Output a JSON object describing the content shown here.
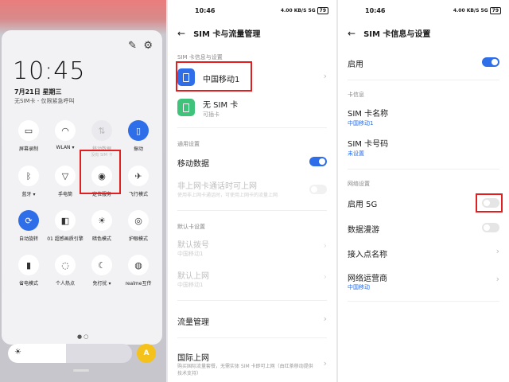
{
  "control_center": {
    "time": "10:45",
    "date": "7月21日 星期三",
    "sim_status": "无SIM卡 - 仅限紧急呼叫",
    "tiles": [
      {
        "label": "屏幕录制",
        "icon": "screen-record-icon",
        "glyph": "▭",
        "state": "off"
      },
      {
        "label": "WLAN ▾",
        "icon": "wifi-icon",
        "glyph": "◠",
        "state": "off"
      },
      {
        "label": "移动数据",
        "sub": "没有 SIM 卡",
        "icon": "mobile-data-icon",
        "glyph": "⇅",
        "state": "dim"
      },
      {
        "label": "振动",
        "icon": "vibrate-icon",
        "glyph": "▯",
        "state": "on"
      },
      {
        "label": "蓝牙 ▾",
        "icon": "bluetooth-icon",
        "glyph": "ᛒ",
        "state": "off"
      },
      {
        "label": "手电筒",
        "icon": "flashlight-icon",
        "glyph": "▽",
        "state": "off"
      },
      {
        "label": "定位服务",
        "icon": "location-icon",
        "glyph": "◉",
        "state": "off"
      },
      {
        "label": "飞行模式",
        "icon": "airplane-icon",
        "glyph": "✈",
        "state": "off"
      },
      {
        "label": "自动旋转",
        "icon": "auto-rotate-icon",
        "glyph": "⟳",
        "state": "on"
      },
      {
        "label": "01 超感画质引擎",
        "icon": "display-engine-icon",
        "glyph": "◧",
        "state": "off"
      },
      {
        "label": "暗色模式",
        "icon": "dark-mode-icon",
        "glyph": "☀",
        "state": "off"
      },
      {
        "label": "护眼模式",
        "icon": "eye-care-icon",
        "glyph": "◎",
        "state": "off"
      },
      {
        "label": "省电模式",
        "icon": "battery-saver-icon",
        "glyph": "▮",
        "state": "off"
      },
      {
        "label": "个人热点",
        "icon": "hotspot-icon",
        "glyph": "◌",
        "state": "off"
      },
      {
        "label": "免打扰 ▾",
        "icon": "do-not-disturb-icon",
        "glyph": "☾",
        "state": "off"
      },
      {
        "label": "realme互传",
        "icon": "realme-share-icon",
        "glyph": "◍",
        "state": "off"
      }
    ],
    "brightness_fraction": 0.47,
    "auto_brightness_label": "A"
  },
  "sim_manage": {
    "status_time": "10:46",
    "status_icons": "4.00 KB/S 5G",
    "battery": "79",
    "title": "SIM 卡与流量管理",
    "section_sim": "SIM 卡信息与设置",
    "sim1_name": "中国移动1",
    "sim2_name": "无 SIM 卡",
    "sim2_sub": "可插卡",
    "section_general": "通用设置",
    "mobile_data": "移动数据",
    "non_sim_data": "非上网卡通话时可上网",
    "non_sim_data_sub": "使用非上网卡通话时，可使用上网卡的流量上网",
    "section_default": "默认卡设置",
    "default_dial": "默认拨号",
    "default_dial_value": "中国移动1",
    "default_data": "默认上网",
    "default_data_value": "中国移动1",
    "traffic_manage": "流量管理",
    "intl_data": "国际上网",
    "intl_data_sub": "购买国际流量套餐，无需实体 SIM 卡即可上网（由红茶移动提供技术支持）"
  },
  "sim_info": {
    "status_time": "10:46",
    "status_icons": "4.00 KB/S 5G",
    "battery": "79",
    "title": "SIM 卡信息与设置",
    "enable": "启用",
    "section_card": "卡信息",
    "sim_name_label": "SIM 卡名称",
    "sim_name_value": "中国移动1",
    "sim_number_label": "SIM 卡号码",
    "sim_number_value": "未设置",
    "section_network": "网络设置",
    "enable_5g": "启用 5G",
    "data_roaming": "数据漫游",
    "apn": "接入点名称",
    "carrier": "网络运营商",
    "carrier_value": "中国移动"
  },
  "icons": {
    "back": "←",
    "chevron": "›",
    "edit": "✎",
    "gear": "⚙",
    "sun": "☀"
  },
  "colors": {
    "accent": "#2e6ee8",
    "highlight": "#e02020",
    "sim2": "#3fc27a",
    "auto": "#f5c21b"
  }
}
